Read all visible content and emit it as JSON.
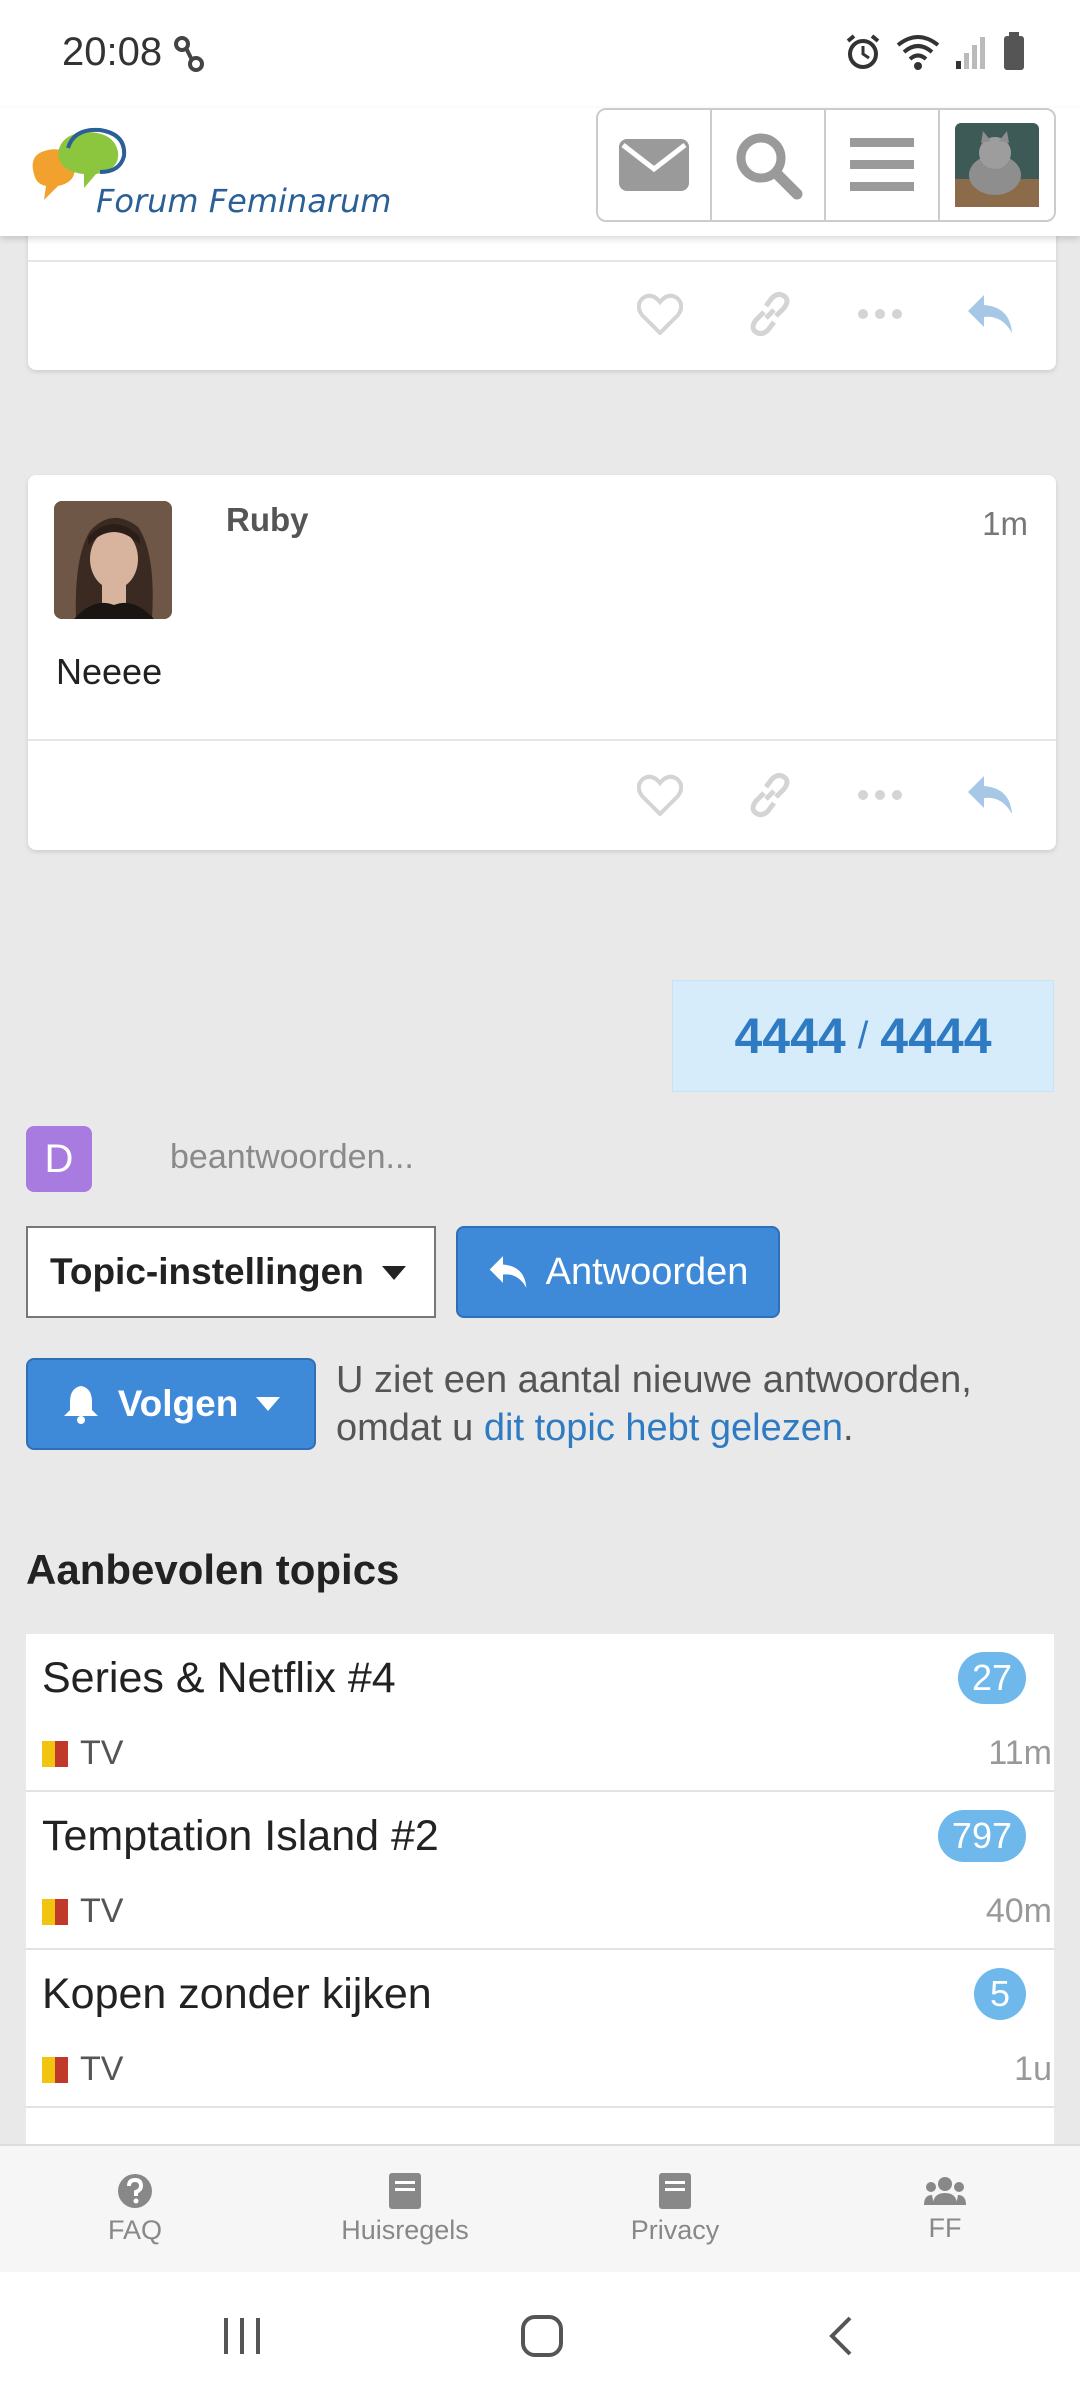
{
  "status_bar": {
    "time": "20:08"
  },
  "header": {
    "logo_text": "Forum Feminarum",
    "buttons": [
      "mail-icon",
      "search-icon",
      "menu-icon",
      "user-avatar"
    ]
  },
  "post": {
    "author": "Ruby",
    "time": "1m",
    "body": "Neeee"
  },
  "progress": {
    "current": "4444",
    "separator": "/",
    "total": "4444"
  },
  "reply": {
    "avatar_letter": "D",
    "placeholder": "beantwoorden..."
  },
  "controls": {
    "settings_label": "Topic-instellingen",
    "reply_label": "Antwoorden",
    "follow_label": "Volgen",
    "follow_text_1": "U ziet een aantal nieuwe antwoorden,",
    "follow_text_2": "omdat u ",
    "follow_link": "dit topic hebt gelezen",
    "follow_text_3": "."
  },
  "recommended": {
    "title": "Aanbevolen topics",
    "topics": [
      {
        "title": "Series & Netflix #4",
        "count": "27",
        "category": "TV",
        "age": "11m"
      },
      {
        "title": "Temptation Island #2",
        "count": "797",
        "category": "TV",
        "age": "40m"
      },
      {
        "title": "Kopen zonder kijken",
        "count": "5",
        "category": "TV",
        "age": "1u"
      }
    ]
  },
  "footer_nav": [
    {
      "label": "FAQ",
      "icon": "question-icon"
    },
    {
      "label": "Huisregels",
      "icon": "book-icon"
    },
    {
      "label": "Privacy",
      "icon": "book-icon"
    },
    {
      "label": "FF",
      "icon": "users-icon"
    }
  ]
}
